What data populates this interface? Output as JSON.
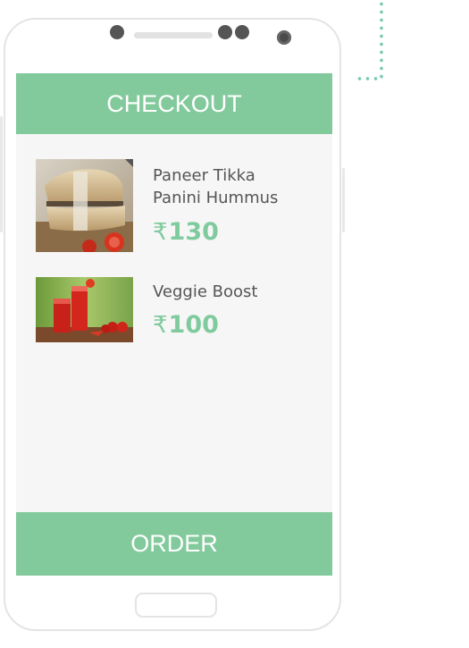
{
  "header": {
    "title": "CHECKOUT"
  },
  "cart": {
    "currency_symbol": "₹",
    "items": [
      {
        "name_line1": "Paneer Tikka",
        "name_line2": "Panini Hummus",
        "price": "130",
        "image": "sandwich-photo"
      },
      {
        "name_line1": "Veggie Boost",
        "price": "100",
        "image": "tomato-juice-photo"
      }
    ]
  },
  "footer": {
    "order_label": "ORDER"
  },
  "colors": {
    "accent": "#82ca9c",
    "price": "#7fcb9e",
    "screen_bg": "#f6f6f6",
    "dots": "#7cc9b5"
  }
}
